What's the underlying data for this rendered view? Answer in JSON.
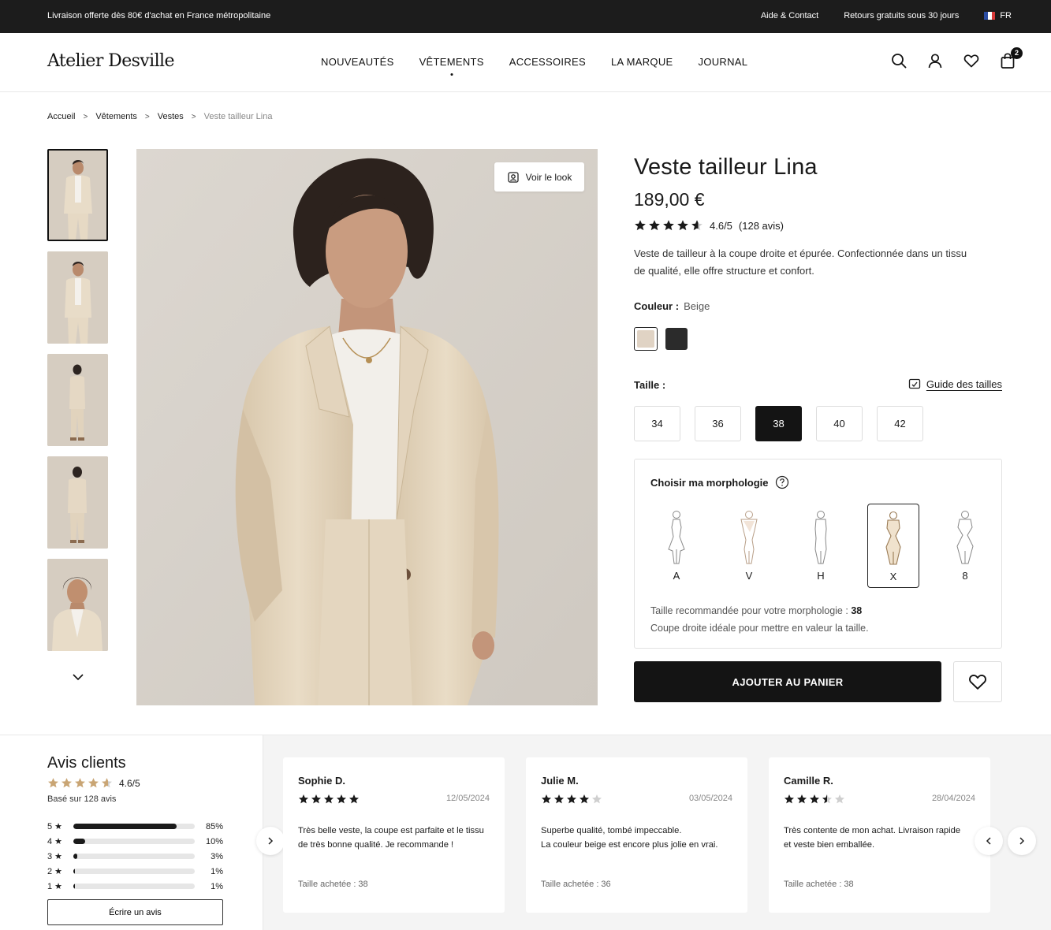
{
  "topbar": {
    "promo": "Livraison offerte dès 80€ d'achat en France métropolitaine",
    "help": "Aide & Contact",
    "returns": "Retours gratuits sous 30 jours",
    "lang": "FR"
  },
  "header": {
    "logo": "Atelier Desville",
    "nav": [
      "NOUVEAUTÉS",
      "VÊTEMENTS",
      "ACCESSOIRES",
      "LA MARQUE",
      "JOURNAL"
    ],
    "active_nav": "VÊTEMENTS",
    "cart_count": "2"
  },
  "breadcrumb": [
    "Accueil",
    "Vêtements",
    "Vestes",
    "Veste tailleur Lina"
  ],
  "gallery": {
    "voir_look": "Voir le look"
  },
  "product": {
    "title": "Veste tailleur Lina",
    "price": "189,00 €",
    "rating": 4.6,
    "rating_text": "4.6/5",
    "reviews_count_text": "(128 avis)",
    "description": "Veste de tailleur à la coupe droite et épurée. Confectionnée dans un tissu de qualité, elle offre structure et confort.",
    "color_label": "Couleur :",
    "color_value": "Beige",
    "colors": [
      "#e0d3c4",
      "#2b2b2b"
    ],
    "size_label": "Taille :",
    "size_guide": "Guide des tailles",
    "sizes": [
      "34",
      "36",
      "38",
      "40",
      "42"
    ],
    "selected_size": "38",
    "morpho": {
      "title": "Choisir ma morphologie",
      "shapes": [
        "A",
        "V",
        "H",
        "X",
        "8"
      ],
      "selected": "X",
      "reco_prefix": "Taille recommandée pour votre morphologie :",
      "reco_size": "38",
      "reco_note": "Coupe droite idéale pour mettre en valeur la taille."
    },
    "add_to_cart": "AJOUTER AU PANIER"
  },
  "reviews": {
    "title": "Avis clients",
    "rating_text": "4.6/5",
    "based_on": "Basé sur 128 avis",
    "distribution": [
      {
        "stars": "5",
        "pct_text": "85%",
        "pct": 85
      },
      {
        "stars": "4",
        "pct_text": "10%",
        "pct": 10
      },
      {
        "stars": "3",
        "pct_text": "3%",
        "pct": 3
      },
      {
        "stars": "2",
        "pct_text": "1%",
        "pct": 1
      },
      {
        "stars": "1",
        "pct_text": "1%",
        "pct": 1
      }
    ],
    "write_review": "Écrire un avis",
    "items": [
      {
        "name": "Sophie D.",
        "rating": 5,
        "date": "12/05/2024",
        "text1": "Très belle veste, la coupe est parfaite et le tissu",
        "text2": "de très bonne qualité. Je recommande !",
        "bought": "Taille achetée : 38"
      },
      {
        "name": "Julie M.",
        "rating": 4,
        "date": "03/05/2024",
        "text1": "Superbe qualité, tombé impeccable.",
        "text2": "La couleur beige est encore plus jolie en vrai.",
        "bought": "Taille achetée : 36"
      },
      {
        "name": "Camille R.",
        "rating": 3.5,
        "date": "28/04/2024",
        "text1": "Très contente de mon achat. Livraison rapide",
        "text2": "et veste bien emballée.",
        "bought": "Taille achetée : 38"
      }
    ]
  }
}
